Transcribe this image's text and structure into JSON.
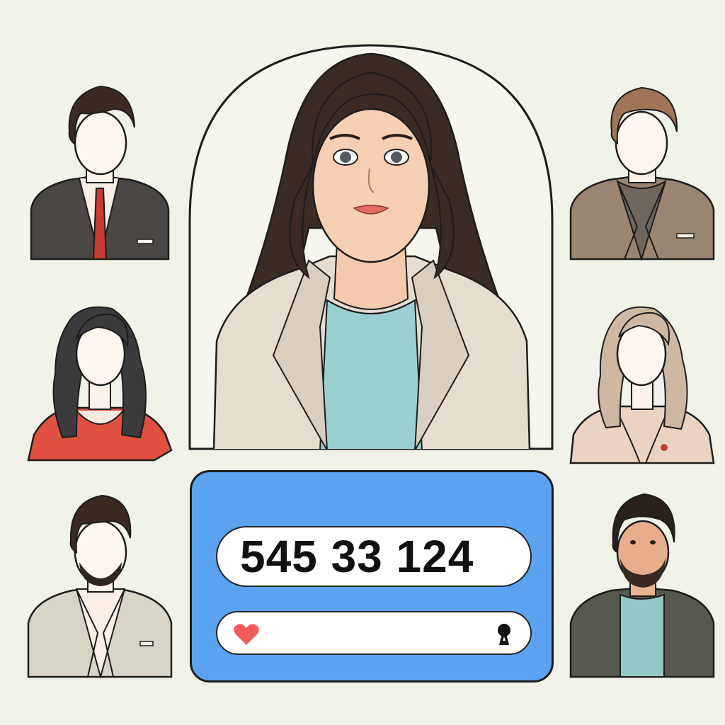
{
  "dialer": {
    "number": "545 33 124"
  },
  "icons": {
    "heart": "heart-icon",
    "lock": "keyhole-icon"
  },
  "colors": {
    "background": "#f1f3e8",
    "panel": "#5ba3f0",
    "heart": "#f25a5a"
  },
  "contacts": [
    {
      "name": "contact-man-suit-red-tie"
    },
    {
      "name": "contact-man-brown-blazer"
    },
    {
      "name": "contact-woman-red-top"
    },
    {
      "name": "contact-woman-blonde"
    },
    {
      "name": "contact-man-beige-blazer"
    },
    {
      "name": "contact-man-beard"
    }
  ]
}
